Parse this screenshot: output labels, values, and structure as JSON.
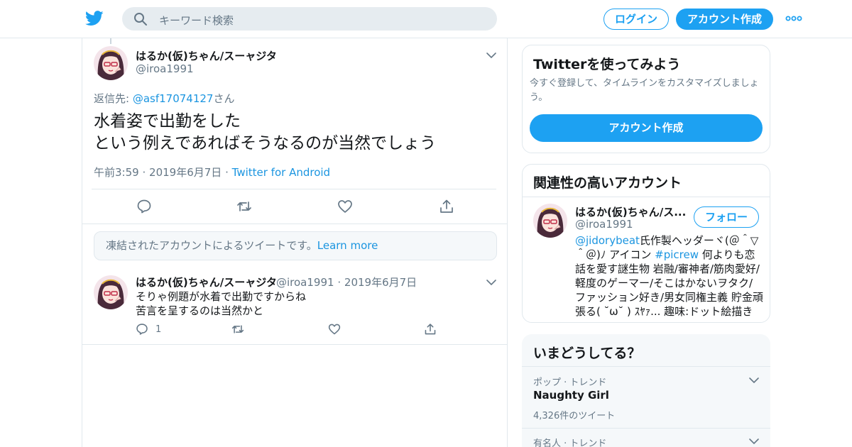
{
  "header": {
    "search_placeholder": "キーワード検索",
    "login_label": "ログイン",
    "signup_label": "アカウント作成",
    "brand_color": "#1da1f2"
  },
  "main_tweet": {
    "name": "はるか(仮)ちゃん/スーャジタ",
    "handle": "@iroa1991",
    "reply_prefix": "返信先: ",
    "reply_handle": "@asf17074127",
    "reply_suffix": "さん",
    "text_line1": "水着姿で出勤をした",
    "text_line2": "という例えであればそうなるのが当然でしょう",
    "time": "午前3:59",
    "date": "2019年6月7日",
    "source": "Twitter for Android"
  },
  "notice": {
    "text": "凍結されたアカウントによるツイートです。",
    "link": "Learn more"
  },
  "reply_tweet": {
    "name": "はるか(仮)ちゃん/スーャジタ",
    "handle": "@iroa1991",
    "date": "2019年6月7日",
    "line1": "そりゃ例題が水着で出勤ですからね",
    "line2": "苦言を呈するのは当然かと",
    "reply_count": "1"
  },
  "sidebar": {
    "signup_card": {
      "title": "Twitterを使ってみよう",
      "sub_line1": "今すぐ登録して、タイムラインをカスタマイズしましょ",
      "sub_line2": "う。",
      "button": "アカウント作成"
    },
    "related": {
      "title": "関連性の高いアカウント",
      "name": "はるか(仮)ちゃん/ス...",
      "handle": "@iroa1991",
      "follow_label": "フォロー",
      "bio_link1": "@jidorybeat",
      "bio_text1": "氏作製ヘッダーヾ(＠＾▽＾＠)ﾉ アイコン ",
      "bio_link2": "#picrew",
      "bio_text2": " 何よりも恋話を愛す謎生物 岩融/審神者/筋肉愛好/軽度のゲーマー/そこはかないヲタク/ファッション好き/男女同権主義 貯金頑張る( ˘ω˘ ) ｽﾔｧ... 趣味:ドット絵描き"
    },
    "trends": {
      "title": "いまどうしてる？",
      "items": [
        {
          "category": "ポップ · トレンド",
          "name": "Naughty Girl",
          "count": "4,326件のツイート"
        },
        {
          "category": "有名人 · トレンド",
          "name": "",
          "count": ""
        }
      ]
    }
  }
}
